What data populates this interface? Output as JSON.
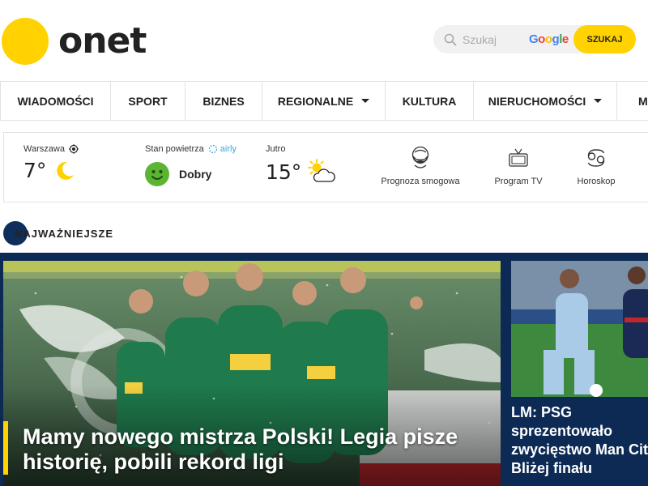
{
  "header": {
    "logo_text": "onet",
    "search": {
      "placeholder": "Szukaj",
      "provider": "Google",
      "button_label": "SZUKAJ"
    }
  },
  "nav": {
    "items": [
      {
        "label": "WIADOMOŚCI",
        "dropdown": false
      },
      {
        "label": "SPORT",
        "dropdown": false
      },
      {
        "label": "BIZNES",
        "dropdown": false
      },
      {
        "label": "REGIONALNE",
        "dropdown": true
      },
      {
        "label": "KULTURA",
        "dropdown": false
      },
      {
        "label": "NIERUCHOMOŚCI",
        "dropdown": true
      },
      {
        "label": "M",
        "dropdown": false
      }
    ]
  },
  "widgets": {
    "weather_now": {
      "city": "Warszawa",
      "temp": "7°",
      "icon": "moon-icon"
    },
    "air_quality": {
      "label": "Stan powietrza",
      "partner": "airly",
      "status": "Dobry",
      "icon": "smiley-icon"
    },
    "weather_tomorrow": {
      "label": "Jutro",
      "temp": "15°",
      "icon": "sun-cloud-icon"
    },
    "links": [
      {
        "label": "Prognoza smogowa",
        "icon": "smog-mask-icon"
      },
      {
        "label": "Program TV",
        "icon": "tv-icon"
      },
      {
        "label": "Horoskop",
        "icon": "zodiac-icon"
      }
    ]
  },
  "section": {
    "title": "NAJWAŻNIEJSZE"
  },
  "hero": {
    "title": "Mamy nowego mistrza Polski! Legia pisze historię, pobili rekord ligi"
  },
  "side_story": {
    "title": "LM: PSG sprezentowało zwycięstwo Man City. Bliżej finału"
  },
  "colors": {
    "brand_yellow": "#ffd200",
    "band_navy": "#0d2a55",
    "air_good_green": "#5bb532"
  }
}
